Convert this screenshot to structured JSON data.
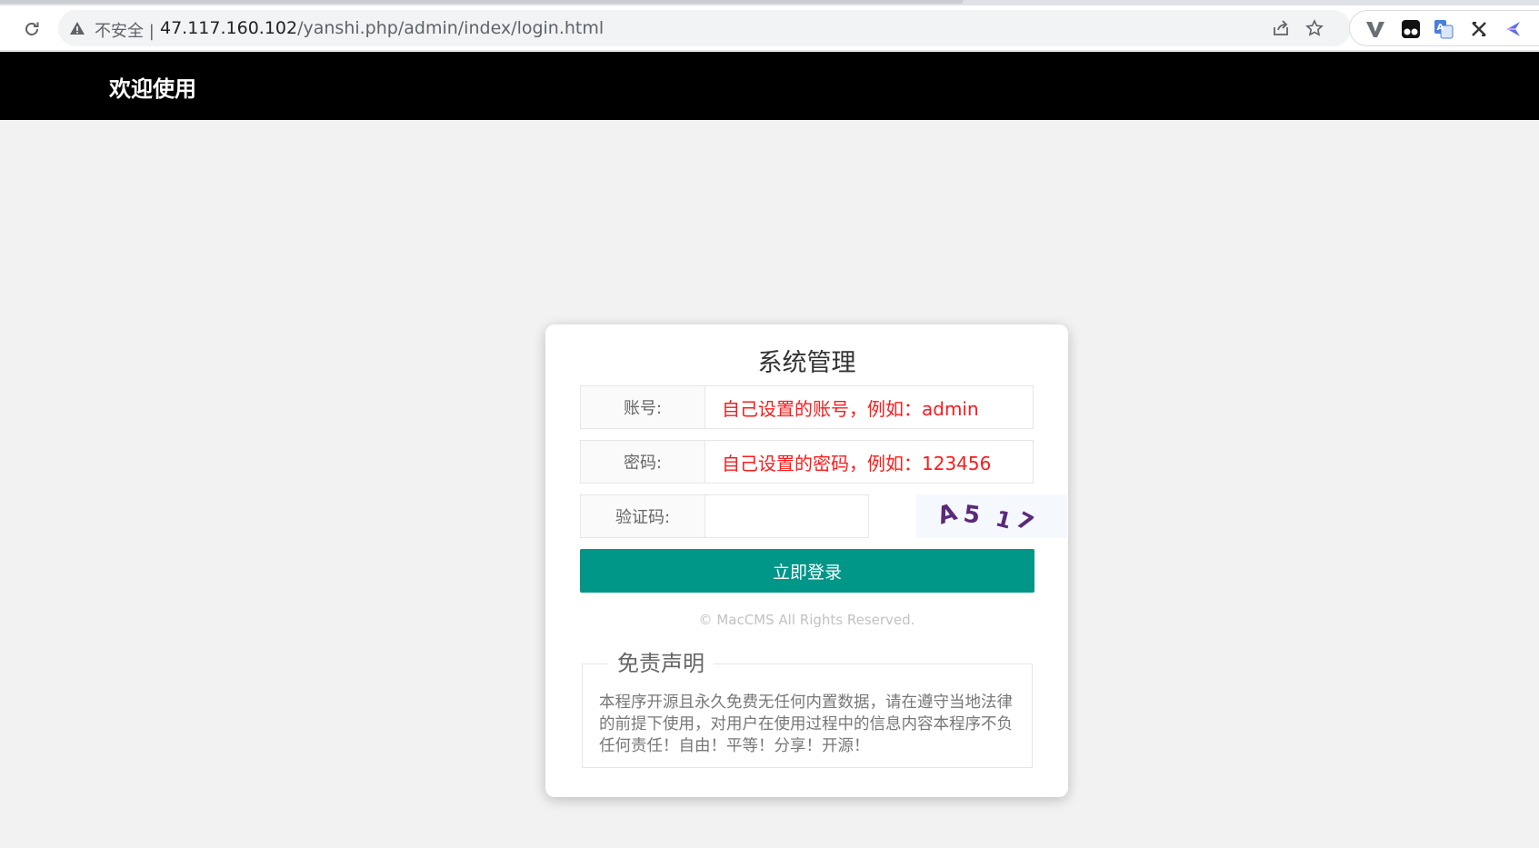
{
  "browser": {
    "security_label": "不安全",
    "separator": "|",
    "url_host": "47.117.160.102",
    "url_path": "/yanshi.php/admin/index/login.html",
    "extensions": [
      "vimium-icon",
      "tampermonkey-icon",
      "translate-icon",
      "xpath-icon",
      "bookmark-extension-icon"
    ]
  },
  "header": {
    "title": "欢迎使用"
  },
  "login": {
    "title": "系统管理",
    "account_label": "账号:",
    "account_value": "自己设置的账号，例如：admin",
    "password_label": "密码:",
    "password_value": "自己设置的密码，例如：123456",
    "captcha_label": "验证码:",
    "captcha_value": "",
    "captcha_text": "A517",
    "submit_label": "立即登录",
    "copyright": "© MacCMS All Rights Reserved."
  },
  "disclaimer": {
    "title": "免责声明",
    "text": "本程序开源且永久免费无任何内置数据，请在遵守当地法律的前提下使用，对用户在使用过程中的信息内容本程序不负任何责任！自由！平等！分享！开源！"
  },
  "colors": {
    "accent": "#009688",
    "header_bg": "#000000",
    "hint_text": "#ff1a1a",
    "page_bg": "#f2f2f2"
  }
}
